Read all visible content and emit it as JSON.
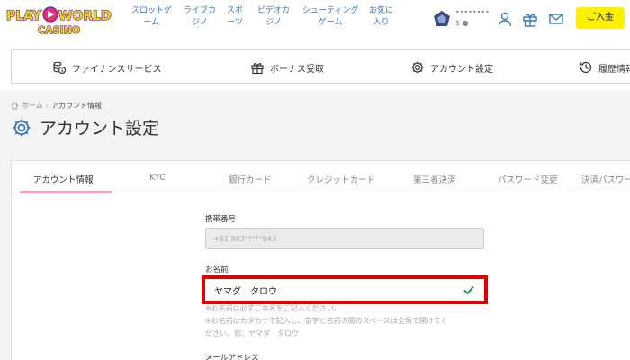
{
  "header": {
    "logo_line1": "PLAY",
    "logo_line2": "WORLD",
    "logo_sub": "CASINO",
    "nav": [
      {
        "label": "スロットゲ\nーム"
      },
      {
        "label": "ライブカ\nジノ"
      },
      {
        "label": "スポ\nーツ"
      },
      {
        "label": "ビデオカ\nジノ"
      },
      {
        "label": "シューティング\nゲーム"
      },
      {
        "label": "お気に\n入り"
      }
    ],
    "user_name": "••••••••",
    "balance": "$ ●",
    "deposit_label": "ご入金",
    "icons": [
      "user-icon",
      "gift-icon",
      "mail-icon"
    ]
  },
  "subnav": [
    {
      "label": "ファイナンスサービス",
      "icon": "finance-icon"
    },
    {
      "label": "ボーナス受取",
      "icon": "gift-icon"
    },
    {
      "label": "アカウント設定",
      "icon": "gear-icon"
    },
    {
      "label": "履歴情報",
      "icon": "history-icon"
    }
  ],
  "breadcrumb": {
    "home": "ホーム",
    "current": "アカウント情報"
  },
  "page_title": "アカウント設定",
  "tabs": [
    {
      "label": "アカウント情報",
      "active": true
    },
    {
      "label": "KYC"
    },
    {
      "label": "銀行カード"
    },
    {
      "label": "クレジットカード"
    },
    {
      "label": "第三者決済"
    },
    {
      "label": "パスワード変更"
    },
    {
      "label": "決済パスワード"
    }
  ],
  "form": {
    "phone_label": "携帯番号",
    "phone_value": "+81 903*****043",
    "name_label": "お名前",
    "name_value": "ヤマダ　タロウ",
    "note1": "※お名前は必ずご本名をご記入ください。",
    "note2": "※お名前はカタカナで記入し、苗字と名前の間のスペースは全角で開けてく",
    "note3": "ださい。例：ヤマダ　タロウ",
    "email_label": "メールアドレス"
  },
  "colors": {
    "accent_blue": "#3a78c3",
    "deposit_yellow": "#ffef00",
    "highlight_red": "#e00000",
    "tab_underline": "#f0a0c0"
  }
}
